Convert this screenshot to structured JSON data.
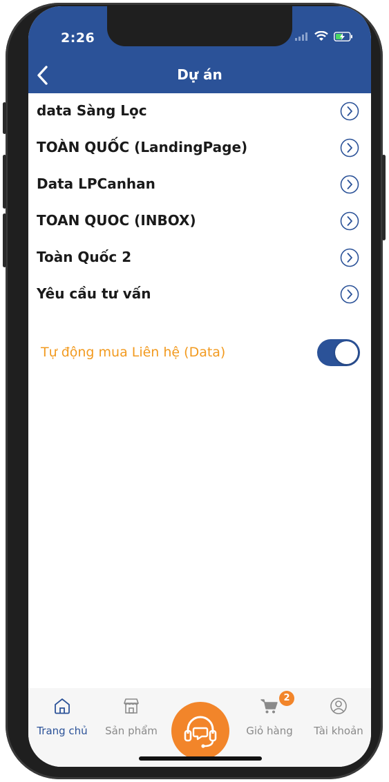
{
  "status_bar": {
    "time": "2:26"
  },
  "nav": {
    "title": "Dự án",
    "back_icon": "chevron-left-icon"
  },
  "projects": [
    {
      "label": "data Sàng Lọc"
    },
    {
      "label": "TOÀN QUỐC (LandingPage)"
    },
    {
      "label": "Data LPCanhan"
    },
    {
      "label": "TOAN QUOC (INBOX)"
    },
    {
      "label": "Toàn Quốc 2"
    },
    {
      "label": "Yêu cầu tư vấn"
    }
  ],
  "auto_buy": {
    "label": "Tự động mua Liên hệ (Data)",
    "enabled": true
  },
  "tabs": {
    "home": "Trang chủ",
    "products": "Sản phẩm",
    "cart": "Giỏ hàng",
    "account": "Tài khoản",
    "cart_badge": "2"
  },
  "colors": {
    "primary": "#2b5298",
    "accent": "#f2852a",
    "toggle_label": "#f29a1f"
  }
}
